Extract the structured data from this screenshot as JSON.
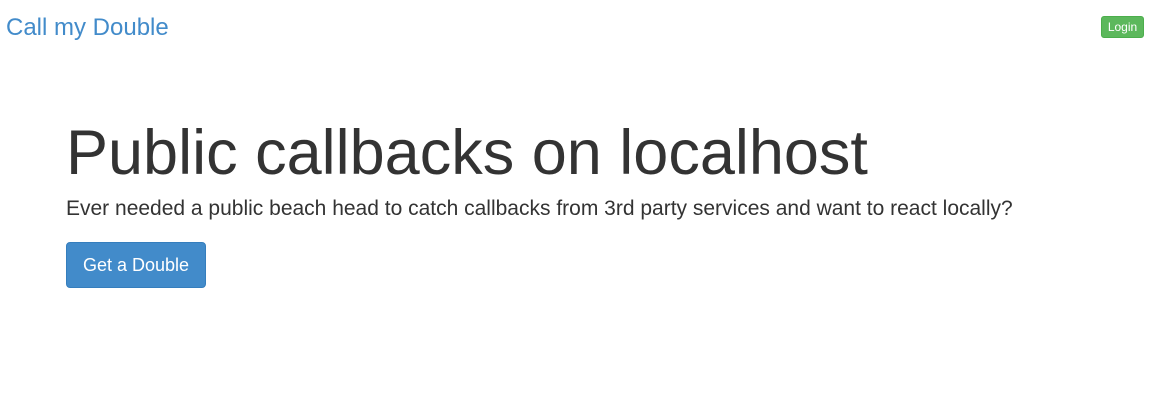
{
  "navbar": {
    "brand": "Call my Double",
    "login_label": "Login"
  },
  "hero": {
    "title": "Public callbacks on localhost",
    "lead": "Ever needed a public beach head to catch callbacks from 3rd party services and want to react locally?",
    "cta_label": "Get a Double"
  },
  "colors": {
    "primary": "#428bca",
    "success": "#5cb85c",
    "text": "#333333"
  }
}
